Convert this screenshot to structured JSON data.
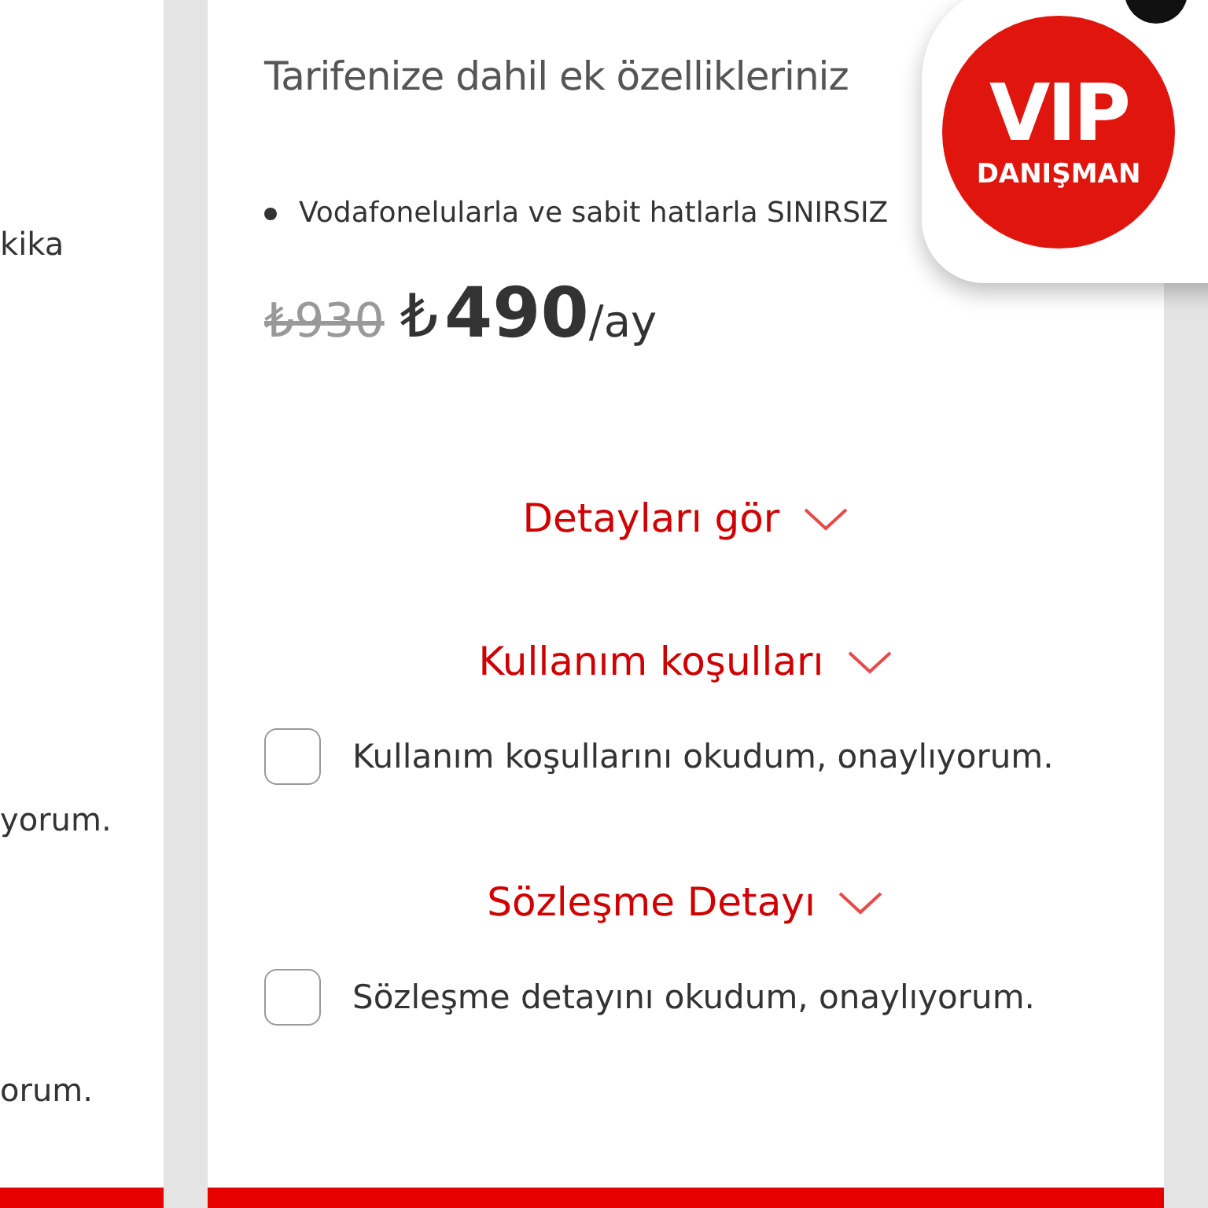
{
  "side_card": {
    "texts": [
      "kika",
      "yorum.",
      "orum."
    ]
  },
  "card": {
    "title": "Tarifenize dahil ek özellikleriniz",
    "features": [
      "Vodafonelularla ve sabit hatlarla SINIRSIZ"
    ],
    "price": {
      "old": "₺930",
      "currency": "₺",
      "amount": "490",
      "period": "/ay"
    },
    "sections": [
      {
        "link": "Detayları gör",
        "expanded": false
      },
      {
        "link": "Kullanım koşulları",
        "expanded": false,
        "consent": {
          "text": "Kullanım koşullarını okudum, onaylıyorum.",
          "checked": false
        }
      },
      {
        "link": "Sözleşme Detayı",
        "expanded": false,
        "consent": {
          "text": "Sözleşme detayını okudum, onaylıyorum.",
          "checked": false
        }
      }
    ]
  },
  "badge": {
    "title": "VIP",
    "subtitle": "DANIŞMAN"
  }
}
